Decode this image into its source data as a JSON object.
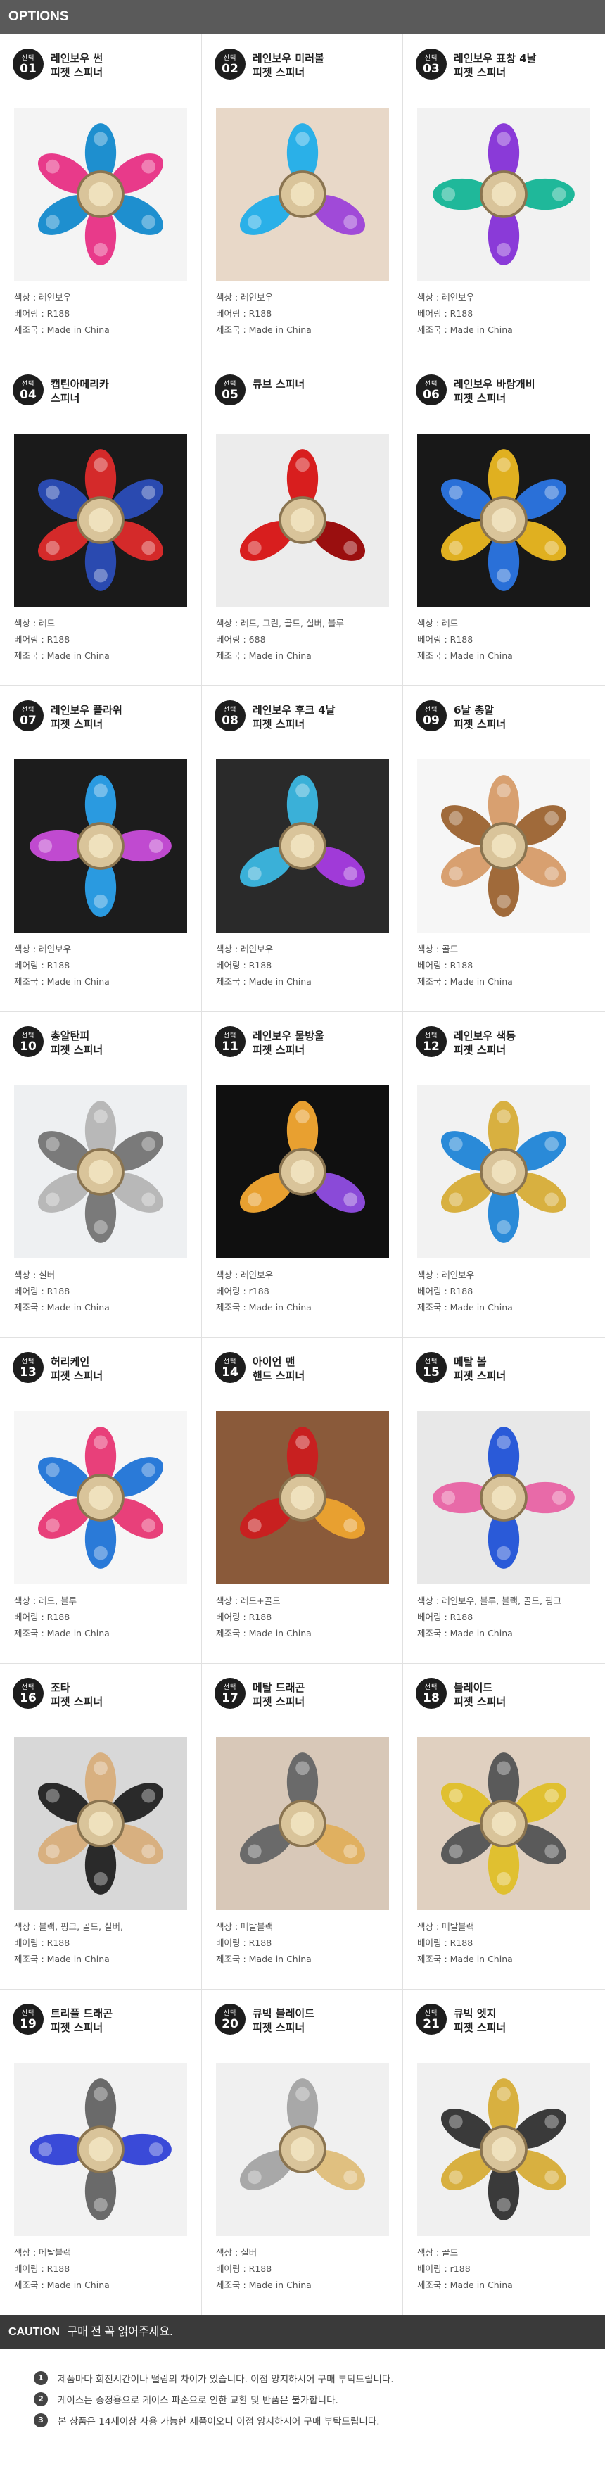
{
  "header": {
    "title": "OPTIONS"
  },
  "badge_label": "선택",
  "products": [
    {
      "num": "01",
      "title": [
        "레인보우 썬",
        "피젯 스피너"
      ],
      "color": "색상 : 레인보우",
      "bearing": "베어링 : R188",
      "origin": "제조국 : Made in China",
      "icon": "rainbow-sun-spinner",
      "c1": "#1e8fcf",
      "c2": "#e83a8a",
      "bg": "#f4f4f4"
    },
    {
      "num": "02",
      "title": [
        "레인보우 미러볼",
        "피젯 스피너"
      ],
      "color": "색상 : 레인보우",
      "bearing": "베어링 : R188",
      "origin": "제조국 : Made in China",
      "icon": "rainbow-mirrorball-spinner",
      "c1": "#2ab0e8",
      "c2": "#a04ad8",
      "bg": "#e8d8c8"
    },
    {
      "num": "03",
      "title": [
        "레인보우 표창 4날",
        "피젯 스피너"
      ],
      "color": "색상 : 레인보우",
      "bearing": "베어링 : R188",
      "origin": "제조국 : Made in China",
      "icon": "rainbow-shuriken-spinner",
      "c1": "#8a3ad8",
      "c2": "#1fb89a",
      "bg": "#f2f2f2"
    },
    {
      "num": "04",
      "title": [
        "캡틴아메리카",
        "스피너"
      ],
      "color": "색상 : 레드",
      "bearing": "베어링 : R188",
      "origin": "제조국 : Made in China",
      "icon": "captain-america-spinner",
      "c1": "#d42a2a",
      "c2": "#2a4ab0",
      "bg": "#1a1a1a"
    },
    {
      "num": "05",
      "title": [
        "큐브 스피너"
      ],
      "color": "색상 : 레드, 그린, 골드, 실버, 블루",
      "bearing": "베어링 : 688",
      "origin": "제조국 : Made in China",
      "icon": "cube-spinner",
      "c1": "#d81e1e",
      "c2": "#9a0f0f",
      "bg": "#ececec"
    },
    {
      "num": "06",
      "title": [
        "레인보우 바람개비",
        "피젯 스피너"
      ],
      "color": "색상 : 레드",
      "bearing": "베어링 : R188",
      "origin": "제조국 : Made in China",
      "icon": "rainbow-pinwheel-spinner",
      "c1": "#e0b020",
      "c2": "#2a70d8",
      "bg": "#181818"
    },
    {
      "num": "07",
      "title": [
        "레인보우 플라워",
        "피젯 스피너"
      ],
      "color": "색상 : 레인보우",
      "bearing": "베어링 : R188",
      "origin": "제조국 : Made in China",
      "icon": "rainbow-flower-spinner",
      "c1": "#2a9ae0",
      "c2": "#c04ad0",
      "bg": "#1c1c1c"
    },
    {
      "num": "08",
      "title": [
        "레인보우 후크 4날",
        "피젯 스피너"
      ],
      "color": "색상 : 레인보우",
      "bearing": "베어링 : R188",
      "origin": "제조국 : Made in China",
      "icon": "rainbow-hook-spinner",
      "c1": "#3ab0d8",
      "c2": "#a03ad8",
      "bg": "#2a2a2a"
    },
    {
      "num": "09",
      "title": [
        "6날 총알",
        "피젯 스피너"
      ],
      "color": "색상 : 골드",
      "bearing": "베어링 : R188",
      "origin": "제조국 : Made in China",
      "icon": "bullet-spinner",
      "c1": "#d8a070",
      "c2": "#a06a3a",
      "bg": "#f6f6f6"
    },
    {
      "num": "10",
      "title": [
        "총알탄피",
        "피젯 스피너"
      ],
      "color": "색상 : 실버",
      "bearing": "베어링 : R188",
      "origin": "제조국 : Made in China",
      "icon": "shell-casing-spinner",
      "c1": "#b8b8b8",
      "c2": "#7a7a7a",
      "bg": "#eef0f2"
    },
    {
      "num": "11",
      "title": [
        "레인보우 물방울",
        "피젯 스피너"
      ],
      "color": "색상 : 레인보우",
      "bearing": "베어링 : r188",
      "origin": "제조국 : Made in China",
      "icon": "rainbow-waterdrop-spinner",
      "c1": "#e8a030",
      "c2": "#8a4ad8",
      "bg": "#101010"
    },
    {
      "num": "12",
      "title": [
        "레인보우 색동",
        "피젯 스피너"
      ],
      "color": "색상 : 레인보우",
      "bearing": "베어링 : R188",
      "origin": "제조국 : Made in China",
      "icon": "rainbow-stripe-spinner",
      "c1": "#d8b040",
      "c2": "#2a8ad8",
      "bg": "#f2f2f2"
    },
    {
      "num": "13",
      "title": [
        "허리케인",
        "피젯 스피너"
      ],
      "color": "색상 : 레드, 블루",
      "bearing": "베어링 : R188",
      "origin": "제조국 : Made in China",
      "icon": "hurricane-spinner",
      "c1": "#e8407a",
      "c2": "#2a7ad8",
      "bg": "#f6f6f6"
    },
    {
      "num": "14",
      "title": [
        "아이언 맨",
        "핸드 스피너"
      ],
      "color": "색상 : 레드+골드",
      "bearing": "베어링 : R188",
      "origin": "제조국 : Made in China",
      "icon": "iron-man-spinner",
      "c1": "#c82020",
      "c2": "#e8a030",
      "bg": "#8a5a3a"
    },
    {
      "num": "15",
      "title": [
        "메탈 볼",
        "피젯 스피너"
      ],
      "color": "색상 : 레인보우, 블루, 블랙, 골드, 핑크",
      "bearing": "베어링 : R188",
      "origin": "제조국 : Made in China",
      "icon": "metal-ball-spinner",
      "c1": "#2a5ad8",
      "c2": "#e86aa8",
      "bg": "#e8e8e8"
    },
    {
      "num": "16",
      "title": [
        "조타",
        "피젯 스피너"
      ],
      "color": "색상 : 블랙, 핑크, 골드, 실버,",
      "bearing": "베어링 : R188",
      "origin": "제조국 : Made in China",
      "icon": "ship-wheel-spinner",
      "c1": "#d8b080",
      "c2": "#2a2a2a",
      "bg": "#d8d8d8"
    },
    {
      "num": "17",
      "title": [
        "메탈 드래곤",
        "피젯 스피너"
      ],
      "color": "색상 : 메탈블랙",
      "bearing": "베어링 : R188",
      "origin": "제조국 : Made in China",
      "icon": "metal-dragon-spinner",
      "c1": "#6a6a6a",
      "c2": "#e0b060",
      "bg": "#d8c8b8"
    },
    {
      "num": "18",
      "title": [
        "블레이드",
        "피젯 스피너"
      ],
      "color": "색상 : 메탈블랙",
      "bearing": "베어링 : R188",
      "origin": "제조국 : Made in China",
      "icon": "blade-spinner",
      "c1": "#5a5a5a",
      "c2": "#e0c030",
      "bg": "#e0d0c0"
    },
    {
      "num": "19",
      "title": [
        "트리플 드래곤",
        "피젯 스피너"
      ],
      "color": "색상 : 메탈블랙",
      "bearing": "베어링 : R188",
      "origin": "제조국 : Made in China",
      "icon": "triple-dragon-spinner",
      "c1": "#6a6a6a",
      "c2": "#3a4ad8",
      "bg": "#f2f2f2"
    },
    {
      "num": "20",
      "title": [
        "큐빅 블레이드",
        "피젯 스피너"
      ],
      "color": "색상 : 실버",
      "bearing": "베어링 : R188",
      "origin": "제조국 : Made in China",
      "icon": "cubic-blade-spinner",
      "c1": "#a8a8a8",
      "c2": "#e0c080",
      "bg": "#f0f0f0"
    },
    {
      "num": "21",
      "title": [
        "큐빅 엣지",
        "피젯 스피너"
      ],
      "color": "색상 : 골드",
      "bearing": "베어링 : r188",
      "origin": "제조국 : Made in China",
      "icon": "cubic-edge-spinner",
      "c1": "#d8b040",
      "c2": "#3a3a3a",
      "bg": "#f0f0f0"
    }
  ],
  "caution": {
    "label": "CAUTION",
    "text": "구매 전 꼭 읽어주세요.",
    "notes": [
      {
        "num": "1",
        "text": "제품마다 회전시간이나 떨림의 차이가 있습니다. 이점 양지하시어 구매 부탁드립니다."
      },
      {
        "num": "2",
        "text": "케이스는 증정용으로 케이스 파손으로 인한 교환 및 반품은 불가합니다."
      },
      {
        "num": "3",
        "text": "본 상품은 14세이상 사용 가능한 제품이오니 이점 양지하시어 구매 부탁드립니다."
      }
    ]
  }
}
